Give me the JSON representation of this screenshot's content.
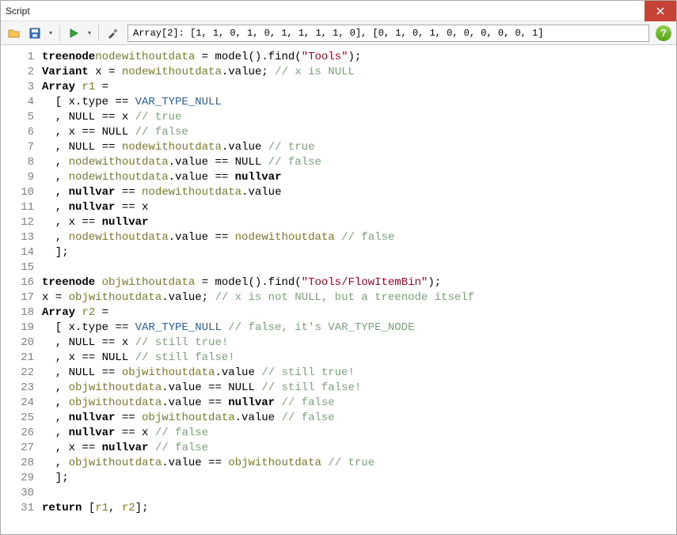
{
  "window": {
    "title": "Script"
  },
  "toolbar": {
    "result_text": "Array[2]: [1, 1, 0, 1, 0, 1, 1, 1, 1, 0], [0, 1, 0, 1, 0, 0, 0, 0, 0, 1]"
  },
  "code": {
    "lines": [
      [
        [
          "kw",
          "treenode"
        ],
        [
          "",
          ""
        ],
        [
          "id",
          "nodewithoutdata"
        ],
        [
          "",
          " = model().find("
        ],
        [
          "str",
          "\"Tools\""
        ],
        [
          "",
          ");"
        ]
      ],
      [
        [
          "kw",
          "Variant"
        ],
        [
          "",
          " x = "
        ],
        [
          "id",
          "nodewithoutdata"
        ],
        [
          "",
          ".value; "
        ],
        [
          "cmt",
          "// x is NULL"
        ]
      ],
      [
        [
          "kw",
          "Array"
        ],
        [
          "",
          " "
        ],
        [
          "id",
          "r1"
        ],
        [
          "",
          " ="
        ]
      ],
      [
        [
          "",
          "  [ x.type == "
        ],
        [
          "cnst",
          "VAR_TYPE_NULL"
        ]
      ],
      [
        [
          "",
          "  , NULL == x "
        ],
        [
          "cmt",
          "// true"
        ]
      ],
      [
        [
          "",
          "  , x == NULL "
        ],
        [
          "cmt",
          "// false"
        ]
      ],
      [
        [
          "",
          "  , NULL == "
        ],
        [
          "id",
          "nodewithoutdata"
        ],
        [
          "",
          ".value "
        ],
        [
          "cmt",
          "// true"
        ]
      ],
      [
        [
          "",
          "  , "
        ],
        [
          "id",
          "nodewithoutdata"
        ],
        [
          "",
          ".value == NULL "
        ],
        [
          "cmt",
          "// false"
        ]
      ],
      [
        [
          "",
          "  , "
        ],
        [
          "id",
          "nodewithoutdata"
        ],
        [
          "",
          ".value == "
        ],
        [
          "kw",
          "nullvar"
        ]
      ],
      [
        [
          "",
          "  , "
        ],
        [
          "kw",
          "nullvar"
        ],
        [
          "",
          " == "
        ],
        [
          "id",
          "nodewithoutdata"
        ],
        [
          "",
          ".value"
        ]
      ],
      [
        [
          "",
          "  , "
        ],
        [
          "kw",
          "nullvar"
        ],
        [
          "",
          " == x"
        ]
      ],
      [
        [
          "",
          "  , x == "
        ],
        [
          "kw",
          "nullvar"
        ]
      ],
      [
        [
          "",
          "  , "
        ],
        [
          "id",
          "nodewithoutdata"
        ],
        [
          "",
          ".value == "
        ],
        [
          "id",
          "nodewithoutdata"
        ],
        [
          "",
          " "
        ],
        [
          "cmt",
          "// false"
        ]
      ],
      [
        [
          "",
          "  ];"
        ]
      ],
      [
        [
          "",
          ""
        ]
      ],
      [
        [
          "kw",
          "treenode"
        ],
        [
          "",
          " "
        ],
        [
          "id",
          "objwithoutdata"
        ],
        [
          "",
          " = model().find("
        ],
        [
          "str",
          "\"Tools/FlowItemBin\""
        ],
        [
          "",
          ");"
        ]
      ],
      [
        [
          "",
          "x = "
        ],
        [
          "id",
          "objwithoutdata"
        ],
        [
          "",
          ".value; "
        ],
        [
          "cmt",
          "// x is not NULL, but a treenode itself"
        ]
      ],
      [
        [
          "kw",
          "Array"
        ],
        [
          "",
          " "
        ],
        [
          "id",
          "r2"
        ],
        [
          "",
          " ="
        ]
      ],
      [
        [
          "",
          "  [ x.type == "
        ],
        [
          "cnst",
          "VAR_TYPE_NULL"
        ],
        [
          "",
          " "
        ],
        [
          "cmt",
          "// false, it's VAR_TYPE_NODE"
        ]
      ],
      [
        [
          "",
          "  , NULL == x "
        ],
        [
          "cmt",
          "// still true!"
        ]
      ],
      [
        [
          "",
          "  , x == NULL "
        ],
        [
          "cmt",
          "// still false!"
        ]
      ],
      [
        [
          "",
          "  , NULL == "
        ],
        [
          "id",
          "objwithoutdata"
        ],
        [
          "",
          ".value "
        ],
        [
          "cmt",
          "// still true!"
        ]
      ],
      [
        [
          "",
          "  , "
        ],
        [
          "id",
          "objwithoutdata"
        ],
        [
          "",
          ".value == NULL "
        ],
        [
          "cmt",
          "// still false!"
        ]
      ],
      [
        [
          "",
          "  , "
        ],
        [
          "id",
          "objwithoutdata"
        ],
        [
          "",
          ".value == "
        ],
        [
          "kw",
          "nullvar"
        ],
        [
          "",
          " "
        ],
        [
          "cmt",
          "// false"
        ]
      ],
      [
        [
          "",
          "  , "
        ],
        [
          "kw",
          "nullvar"
        ],
        [
          "",
          " == "
        ],
        [
          "id",
          "objwithoutdata"
        ],
        [
          "",
          ".value "
        ],
        [
          "cmt",
          "// false"
        ]
      ],
      [
        [
          "",
          "  , "
        ],
        [
          "kw",
          "nullvar"
        ],
        [
          "",
          " == x "
        ],
        [
          "cmt",
          "// false"
        ]
      ],
      [
        [
          "",
          "  , x == "
        ],
        [
          "kw",
          "nullvar"
        ],
        [
          "",
          " "
        ],
        [
          "cmt",
          "// false"
        ]
      ],
      [
        [
          "",
          "  , "
        ],
        [
          "id",
          "objwithoutdata"
        ],
        [
          "",
          ".value == "
        ],
        [
          "id",
          "objwithoutdata"
        ],
        [
          "",
          " "
        ],
        [
          "cmt",
          "// true"
        ]
      ],
      [
        [
          "",
          "  ];"
        ]
      ],
      [
        [
          "",
          ""
        ]
      ],
      [
        [
          "kw",
          "return"
        ],
        [
          "",
          " ["
        ],
        [
          "id",
          "r1"
        ],
        [
          "",
          ", "
        ],
        [
          "id",
          "r2"
        ],
        [
          "",
          "];"
        ]
      ]
    ]
  }
}
